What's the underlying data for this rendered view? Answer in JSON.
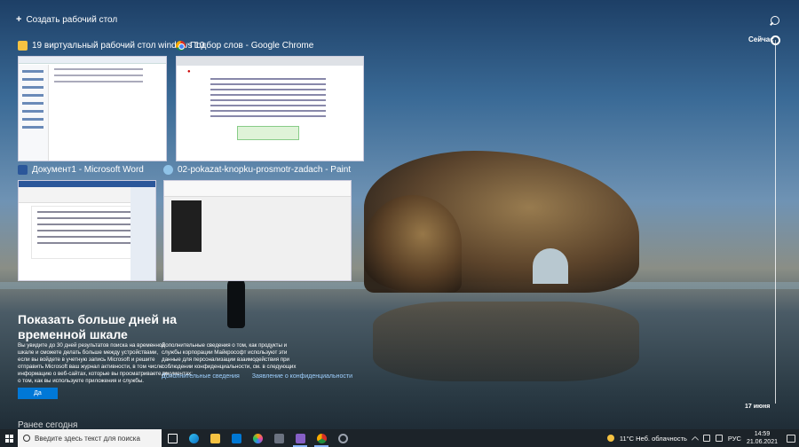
{
  "new_desktop": {
    "label": "Создать рабочий стол"
  },
  "windows": [
    {
      "title": "19 виртуальный рабочий стол windows 10",
      "icon": "folder-icon"
    },
    {
      "title": "Подбор слов - Google Chrome",
      "icon": "chrome-icon"
    },
    {
      "title": "Документ1 - Microsoft Word",
      "icon": "word-icon"
    },
    {
      "title": "02-pokazat-knopku-prosmotr-zadach - Paint",
      "icon": "paint-icon"
    }
  ],
  "timeline": {
    "now_label": "Сейчас",
    "date_label": "17 июня"
  },
  "promo": {
    "title": "Показать больше дней на временной шкале",
    "text": "Вы увидите до 30 дней результатов поиска на временной шкале и сможете делать больше между устройствами, если вы войдете в учетную запись Microsoft и решите отправить Microsoft ваш журнал активности, в том числе информацию о веб-сайтах, которые вы просматриваете, и о том, как вы используете приложения и службы.",
    "yes_button": "Да",
    "info": "Дополнительные сведения о том, как продукты и службы корпорации Майкрософт используют эти данные для персонализации взаимодействия при соблюдении конфиденциальности, см. в следующих документах:",
    "link_more": "Дополнительные сведения",
    "link_privacy": "Заявление о конфиденциальности",
    "cut_text": "Ранее сегодня"
  },
  "taskbar": {
    "search_placeholder": "Введите здесь текст для поиска",
    "pinned_icons": [
      "task-view-icon",
      "edge-icon",
      "file-explorer-icon",
      "mail-icon",
      "paint3d-icon",
      "notepad-icon",
      "visual-studio-icon",
      "chrome-icon",
      "settings-icon"
    ],
    "weather": "11°C  Неб. облачность",
    "language": "РУС",
    "time": "14:59",
    "date": "21.06.2021"
  },
  "colors": {
    "accent": "#0078d7",
    "taskbar": "#1c2329"
  }
}
